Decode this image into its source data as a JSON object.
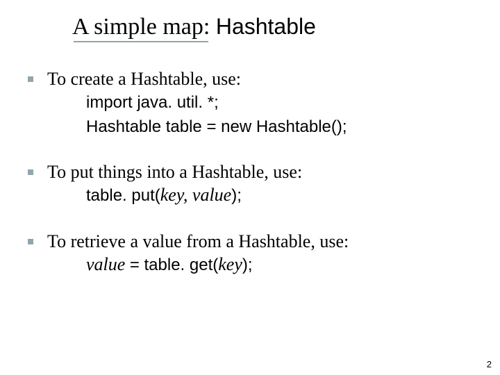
{
  "title": {
    "part1": "A simple map:",
    "part2": " Hashtable"
  },
  "items": [
    {
      "lead": "To create a Hashtable, use:",
      "code": [
        "import java. util. *;",
        "Hashtable table = new Hashtable();"
      ]
    },
    {
      "lead": "To put things into a Hashtable, use:",
      "code": [
        {
          "a": "table. put(",
          "b": "key, value",
          "c": ");"
        }
      ]
    },
    {
      "lead": "To retrieve a value from a Hashtable, use:",
      "code": [
        {
          "a": "value ",
          "b": "= table. get(",
          "c": "key",
          "d": ");"
        }
      ]
    }
  ],
  "pageNumber": "2"
}
